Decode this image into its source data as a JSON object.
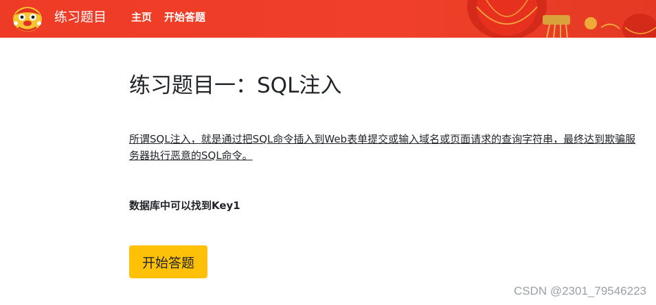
{
  "navbar": {
    "brand": "练习题目",
    "links": [
      "主页",
      "开始答题"
    ],
    "logo_icon": "lion-dance-icon",
    "decoration_icon": "red-lantern-icon",
    "background_color": "#ee3b26"
  },
  "main": {
    "title": "练习题目一：SQL注入",
    "description": "所谓SQL注入，就是通过把SQL命令插入到Web表单提交或输入域名或页面请求的查询字符串，最终达到欺骗服务器执行恶意的SQL命令。",
    "hint": "数据库中可以找到Key1",
    "start_button": "开始答题",
    "button_color": "#ffc107"
  },
  "watermark": "CSDN @2301_79546223"
}
